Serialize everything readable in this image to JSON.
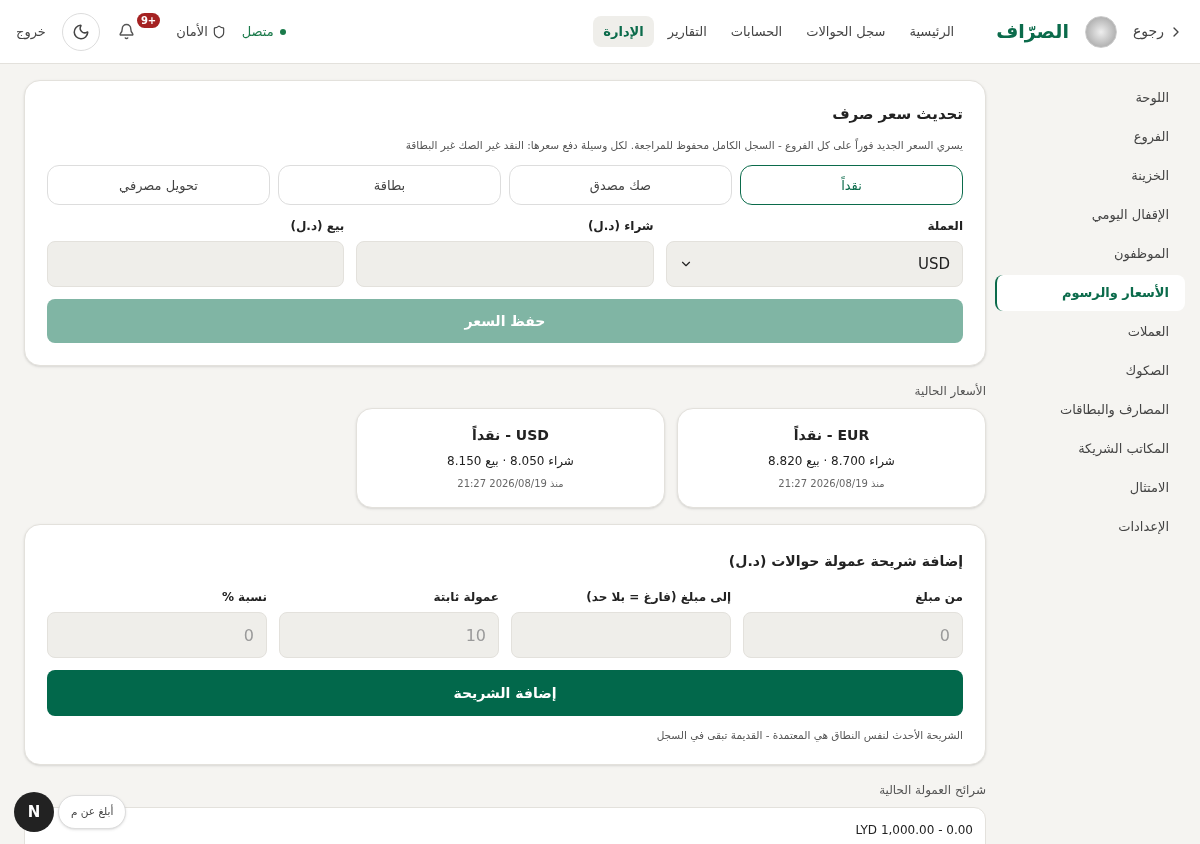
{
  "header": {
    "back": "رجوع",
    "brand": "الصرّاف",
    "nav": [
      {
        "label": "الرئيسية",
        "selected": false
      },
      {
        "label": "سجل الحوالات",
        "selected": false
      },
      {
        "label": "الحسابات",
        "selected": false
      },
      {
        "label": "التقارير",
        "selected": false
      },
      {
        "label": "الإدارة",
        "selected": true
      }
    ],
    "status": "متصل",
    "security": "الأمان",
    "notifications": "+9",
    "logout": "خروج"
  },
  "sidebar": {
    "items": [
      {
        "label": "اللوحة",
        "selected": false
      },
      {
        "label": "الفروع",
        "selected": false
      },
      {
        "label": "الخزينة",
        "selected": false
      },
      {
        "label": "الإقفال اليومي",
        "selected": false
      },
      {
        "label": "الموظفون",
        "selected": false
      },
      {
        "label": "الأسعار والرسوم",
        "selected": true
      },
      {
        "label": "العملات",
        "selected": false
      },
      {
        "label": "الصكوك",
        "selected": false
      },
      {
        "label": "المصارف والبطاقات",
        "selected": false
      },
      {
        "label": "المكاتب الشريكة",
        "selected": false
      },
      {
        "label": "الامتثال",
        "selected": false
      },
      {
        "label": "الإعدادات",
        "selected": false
      }
    ]
  },
  "rate_form": {
    "title": "تحديث سعر صرف",
    "description": "يسري السعر الجديد فوراً على كل الفروع - السجل الكامل محفوظ للمراجعة. لكل وسيلة دفع سعرها: النقد غير الصك غير البطاقة",
    "methods": [
      {
        "label": "نقداً",
        "selected": true
      },
      {
        "label": "صك مصدق",
        "selected": false
      },
      {
        "label": "بطاقة",
        "selected": false
      },
      {
        "label": "تحويل مصرفي",
        "selected": false
      }
    ],
    "currency_label": "العملة",
    "currency_value": "USD",
    "buy_label": "شراء (د.ل)",
    "sell_label": "بيع (د.ل)",
    "save": "حفظ السعر",
    "save_disabled": true
  },
  "current_rates": {
    "title": "الأسعار الحالية",
    "cards": [
      {
        "title": "EUR - نقداً",
        "rates": "شراء 8.700 · بيع 8.820",
        "since": "منذ 2026/08/19 21:27"
      },
      {
        "title": "USD - نقداً",
        "rates": "شراء 8.050 · بيع 8.150",
        "since": "منذ 2026/08/19 21:27"
      }
    ]
  },
  "fee_form": {
    "title": "إضافة شريحة عمولة حوالات (د.ل)",
    "fields": [
      {
        "label": "من مبلغ",
        "placeholder": "0"
      },
      {
        "label": "إلى مبلغ (فارغ = بلا حد)"
      },
      {
        "label": "عمولة ثابتة",
        "placeholder": "10"
      },
      {
        "label": "نسبة %",
        "placeholder": "0"
      }
    ],
    "add": "إضافة الشريحة",
    "note": "الشريحة الأحدث لنفس النطاق هي المعتمدة - القديمة تبقى في السجل"
  },
  "current_fees": {
    "title": "شرائح العمولة الحالية",
    "rows": [
      "LYD 1,000.00 - 0.00"
    ]
  },
  "dev_overlay": {
    "badge": "N",
    "report": "أبلغ عن م"
  }
}
